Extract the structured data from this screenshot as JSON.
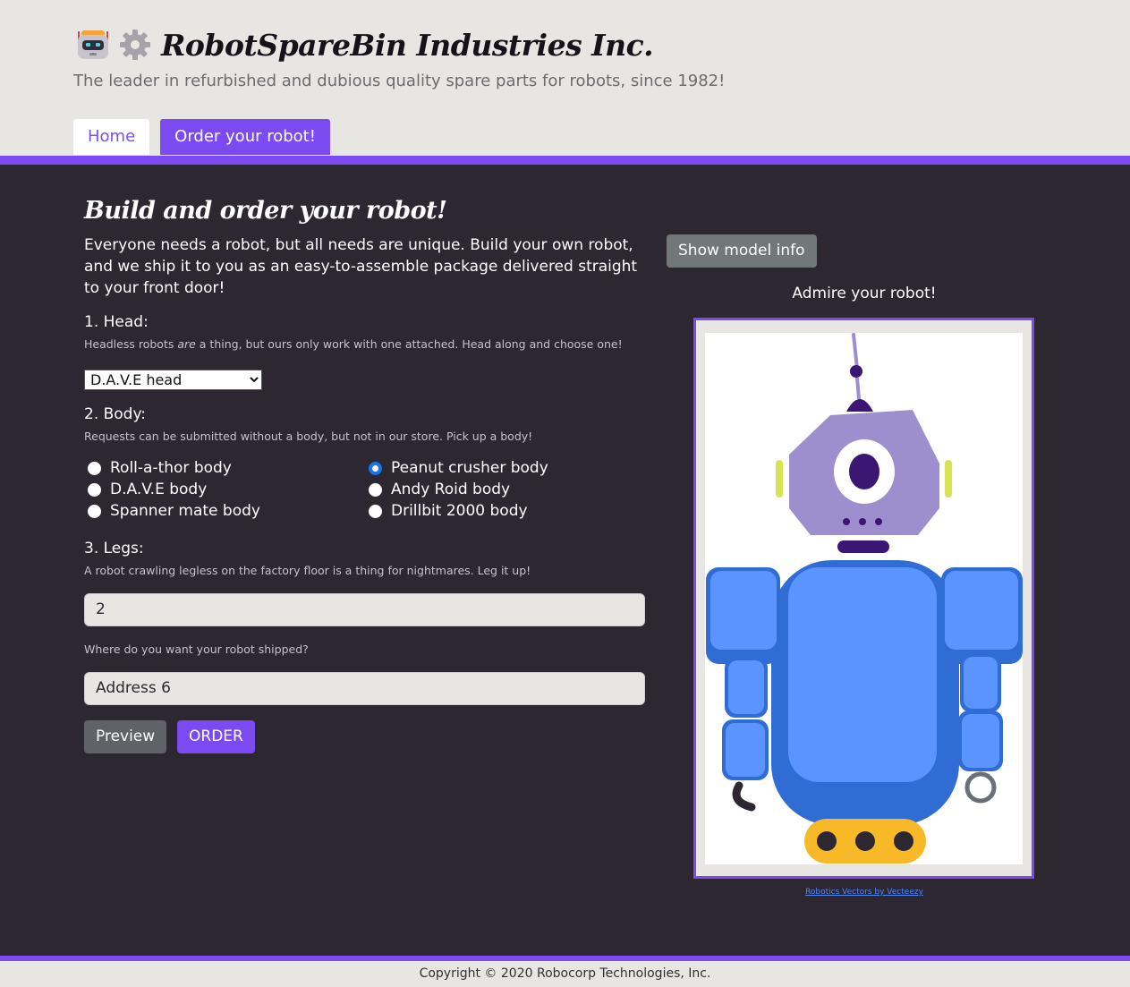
{
  "brand": {
    "title": "RobotSpareBin Industries Inc.",
    "tagline": "The leader in refurbished and dubious quality spare parts for robots, since 1982!"
  },
  "nav": {
    "tabs": [
      {
        "label": "Home"
      },
      {
        "label": "Order your robot!"
      }
    ]
  },
  "form": {
    "title": "Build and order your robot!",
    "intro": "Everyone needs a robot, but all needs are unique. Build your own robot, and we ship it to you as an easy-to-assemble package delivered straight to your front door!",
    "head": {
      "label": "1. Head:",
      "help_pre": "Headless robots ",
      "help_em": "are",
      "help_post": " a thing, but ours only work with one attached. Head along and choose one!",
      "selected": "D.A.V.E head"
    },
    "body": {
      "label": "2. Body:",
      "help": "Requests can be submitted without a body, but not in our store. Pick up a body!",
      "options": [
        {
          "label": "Roll-a-thor body",
          "checked": false
        },
        {
          "label": "D.A.V.E body",
          "checked": false
        },
        {
          "label": "Spanner mate body",
          "checked": false
        },
        {
          "label": "Peanut crusher body",
          "checked": true
        },
        {
          "label": "Andy Roid body",
          "checked": false
        },
        {
          "label": "Drillbit 2000 body",
          "checked": false
        }
      ]
    },
    "legs": {
      "label": "3. Legs:",
      "help": "A robot crawling legless on the factory floor is a thing for nightmares. Leg it up!",
      "value": "2"
    },
    "address": {
      "help": "Where do you want your robot shipped?",
      "value": "Address 6"
    },
    "buttons": {
      "preview": "Preview",
      "order": "ORDER"
    }
  },
  "preview": {
    "info_button": "Show model info",
    "title": "Admire your robot!",
    "credit": "Robotics Vectors by Vecteezy"
  },
  "footer": {
    "text": "Copyright © 2020 Robocorp Technologies, Inc."
  },
  "colors": {
    "accent": "#7b4af0",
    "dark_bg": "#2c2730",
    "light_bg": "#e8e6e3",
    "radio_checked": "#1a73e8"
  },
  "icons": [
    "robot-logo-icon",
    "gear-logo-icon"
  ]
}
